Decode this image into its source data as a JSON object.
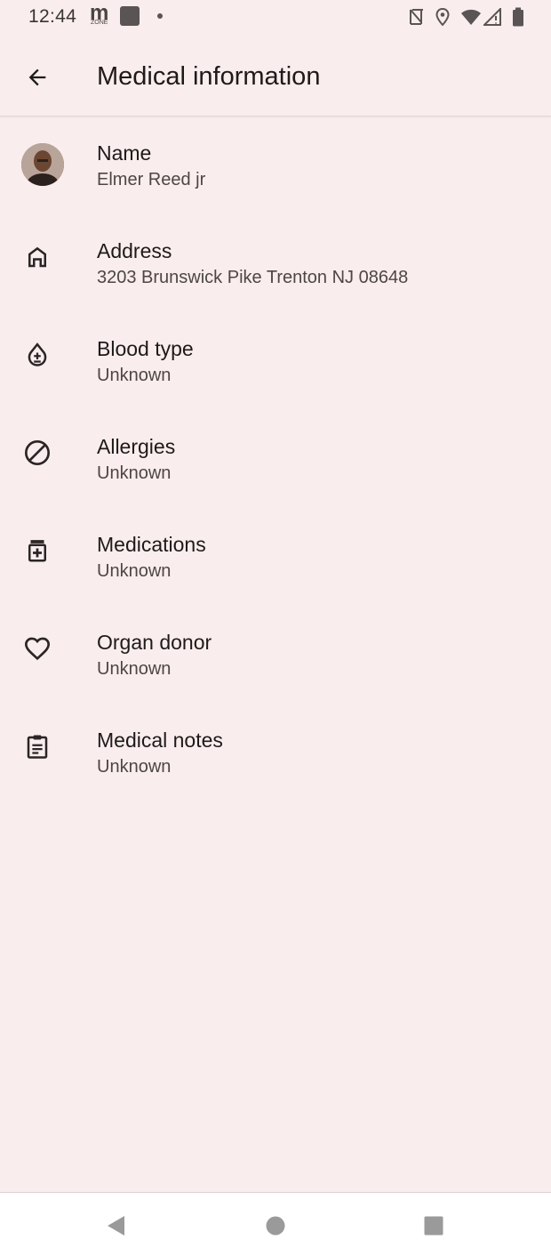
{
  "status_bar": {
    "time": "12:44",
    "app_badge_letter": "m",
    "app_badge_sub": "ZONE",
    "icons": [
      "notification-square-icon",
      "dot-icon",
      "nfc-icon",
      "location-icon",
      "wifi-icon",
      "signal-icon",
      "battery-icon"
    ]
  },
  "app_bar": {
    "title": "Medical information",
    "back_icon": "arrow-back-icon"
  },
  "rows": [
    {
      "icon": "avatar",
      "label": "Name",
      "value": "Elmer Reed jr"
    },
    {
      "icon": "home-icon",
      "label": "Address",
      "value": "3203 Brunswick Pike Trenton NJ 08648"
    },
    {
      "icon": "blood-drop-icon",
      "label": "Blood type",
      "value": "Unknown"
    },
    {
      "icon": "block-icon",
      "label": "Allergies",
      "value": "Unknown"
    },
    {
      "icon": "medication-icon",
      "label": "Medications",
      "value": "Unknown"
    },
    {
      "icon": "heart-icon",
      "label": "Organ donor",
      "value": "Unknown"
    },
    {
      "icon": "clipboard-icon",
      "label": "Medical notes",
      "value": "Unknown"
    }
  ],
  "nav_bar": {
    "icons": [
      "back-triangle-icon",
      "home-circle-icon",
      "recents-square-icon"
    ]
  },
  "colors": {
    "background": "#f9eded",
    "text_primary": "#1f1a1a",
    "text_secondary": "#4e4646",
    "nav_background": "#ffffff",
    "nav_icon": "#9a9a9a"
  }
}
